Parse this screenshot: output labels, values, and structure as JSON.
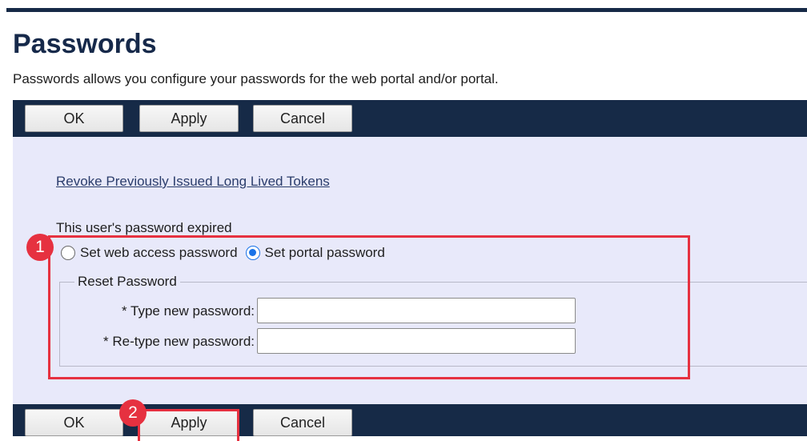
{
  "page": {
    "title": "Passwords",
    "description": "Passwords allows you configure your passwords for the web portal and/or portal."
  },
  "toolbar_top": {
    "ok": "OK",
    "apply": "Apply",
    "cancel": "Cancel"
  },
  "toolbar_bottom": {
    "ok": "OK",
    "apply": "Apply",
    "cancel": "Cancel"
  },
  "content": {
    "revoke_link": "Revoke Previously Issued Long Lived Tokens",
    "expired_label": "This user's password expired",
    "radio_options": [
      {
        "label": "Set web access password",
        "checked": false
      },
      {
        "label": "Set portal password",
        "checked": true
      }
    ],
    "reset_group": {
      "legend": "Reset Password",
      "new_password_label": "* Type new password:",
      "new_password_value": "",
      "retype_password_label": "* Re-type new password:",
      "retype_password_value": ""
    }
  },
  "annotations": [
    {
      "number": "1"
    },
    {
      "number": "2"
    }
  ],
  "colors": {
    "toolbar": "#162a47",
    "content_bg": "#e8e9fa",
    "annotation": "#e63140",
    "radio_accent": "#1a73e8"
  }
}
